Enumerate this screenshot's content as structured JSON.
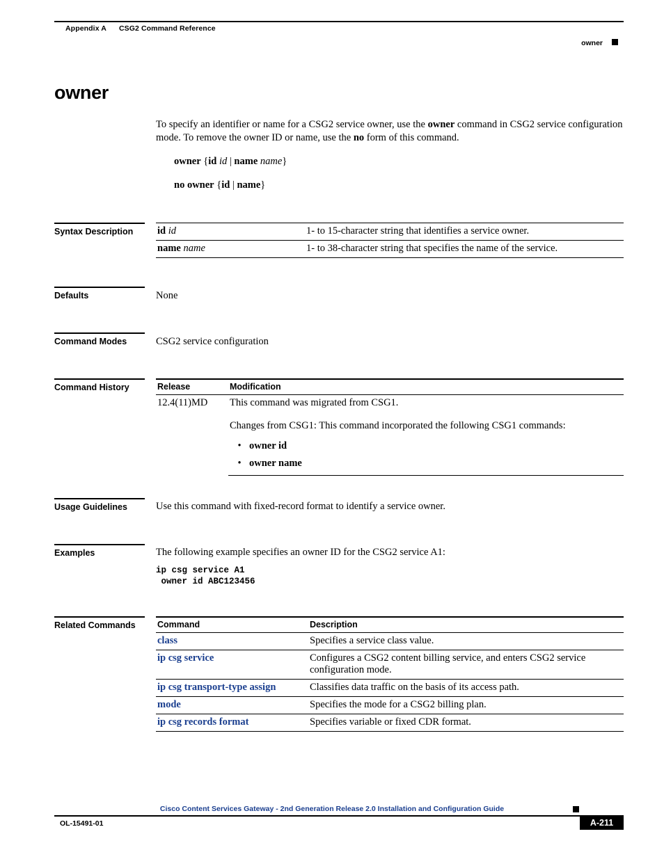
{
  "header": {
    "appendix": "Appendix A",
    "appendix_title": "CSG2 Command Reference",
    "running_head": "owner"
  },
  "title": "owner",
  "intro": {
    "text_part1": "To specify an identifier or name for a CSG2 service owner, use the ",
    "bold1": "owner",
    "text_part2": " command in CSG2 service configuration mode. To remove the owner ID or name, use the ",
    "bold2": "no",
    "text_part3": " form of this command."
  },
  "syntax": {
    "line1_open": "{",
    "line1_id_bold": "id",
    "line1_id_italic": "id",
    "line1_pipe": " | ",
    "line1_name_bold": "name",
    "line1_name_italic": "name",
    "line1_close": "}",
    "line1_cmd": "owner",
    "line2_cmd": "no owner",
    "line2_open": "{",
    "line2_id": "id",
    "line2_pipe": " | ",
    "line2_name": "name",
    "line2_close": "}"
  },
  "sections": {
    "syntax_description": "Syntax Description",
    "defaults": "Defaults",
    "command_modes": "Command Modes",
    "command_history": "Command History",
    "usage_guidelines": "Usage Guidelines",
    "examples": "Examples",
    "related_commands": "Related Commands"
  },
  "syntax_description_table": {
    "rows": [
      {
        "term_bold": "id",
        "term_italic": "id",
        "description": "1- to 15-character string that identifies a service owner."
      },
      {
        "term_bold": "name",
        "term_italic": "name",
        "description": "1- to 38-character string that specifies the name of the service."
      }
    ]
  },
  "defaults_value": "None",
  "command_modes_value": "CSG2 service configuration",
  "command_history_table": {
    "headers": [
      "Release",
      "Modification"
    ],
    "release": "12.4(11)MD",
    "modification_line1": "This command was migrated from CSG1.",
    "modification_line2": "Changes from CSG1: This command incorporated the following CSG1 commands:",
    "bullets": [
      "owner id",
      "owner name"
    ]
  },
  "usage_guidelines_value": "Use this command with fixed-record format to identify a service owner.",
  "examples": {
    "intro": "The following example specifies an owner ID for the CSG2 service A1:",
    "code": "ip csg service A1\n owner id ABC123456"
  },
  "related_commands_table": {
    "headers": [
      "Command",
      "Description"
    ],
    "rows": [
      {
        "command": "class",
        "description": "Specifies a service class value."
      },
      {
        "command": "ip csg service",
        "description": "Configures a CSG2 content billing service, and enters CSG2 service configuration mode."
      },
      {
        "command": "ip csg transport-type assign",
        "description": "Classifies data traffic on the basis of its access path."
      },
      {
        "command": "mode",
        "description": "Specifies the mode for a CSG2 billing plan."
      },
      {
        "command": "ip csg records format",
        "description": "Specifies variable or fixed CDR format."
      }
    ]
  },
  "footer": {
    "doc_title": "Cisco Content Services Gateway - 2nd Generation Release 2.0 Installation and Configuration Guide",
    "doc_id": "OL-15491-01",
    "page_number": "A-211"
  },
  "colors": {
    "link": "#1b3f8f",
    "rule": "#000000"
  }
}
